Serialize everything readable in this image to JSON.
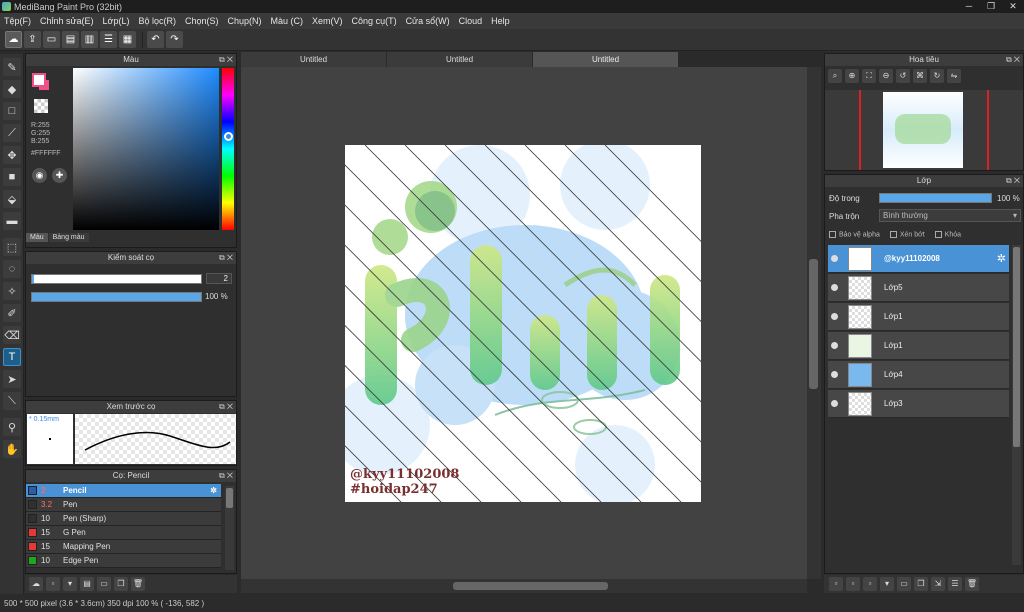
{
  "window": {
    "title": "MediBang Paint Pro (32bit)"
  },
  "menu": [
    "Tệp(F)",
    "Chỉnh sửa(E)",
    "Lớp(L)",
    "Bộ lọc(R)",
    "Chọn(S)",
    "Chụp(N)",
    "Màu (C)",
    "Xem(V)",
    "Công cụ(T)",
    "Cửa sổ(W)",
    "Cloud",
    "Help"
  ],
  "tabs": [
    "Untitled",
    "Untitled",
    "Untitled"
  ],
  "color_panel": {
    "title": "Màu",
    "rgb": [
      "R:255",
      "G:255",
      "B:255"
    ],
    "hex": "#FFFFFF",
    "tabs": [
      "Màu",
      "Bảng màu"
    ],
    "foreground": "#ffffff",
    "accent": "#f0508a"
  },
  "brush_control": {
    "title": "Kiểm soát cọ",
    "size": "2",
    "opacity": "100 %",
    "size_fraction": 0.01,
    "opacity_fraction": 1.0
  },
  "brush_preview": {
    "title": "Xem trước cọ",
    "size_label": "* 0.15mm"
  },
  "brush_list": {
    "title": "Cọ: Pencil",
    "items": [
      {
        "size": "2",
        "name": "Pencil",
        "color": "#2a5fa8",
        "selected": true
      },
      {
        "size": "3.2",
        "name": "Pen",
        "color": "#303030",
        "selected": false
      },
      {
        "size": "10",
        "name": "Pen (Sharp)",
        "color": "#303030",
        "selected": false
      },
      {
        "size": "15",
        "name": "G Pen",
        "color": "#e53935",
        "selected": false
      },
      {
        "size": "15",
        "name": "Mapping Pen",
        "color": "#e53935",
        "selected": false
      },
      {
        "size": "10",
        "name": "Edge Pen",
        "color": "#1fa81f",
        "selected": false
      }
    ]
  },
  "navigator": {
    "title": "Hoa tiêu"
  },
  "layers": {
    "title": "Lớp",
    "opacity_label": "Độ trong",
    "opacity_value": "100 %",
    "blend_label": "Pha trộn",
    "blend_value": "Bình thường",
    "options": [
      "Bảo vệ alpha",
      "Xén bớt",
      "Khóa"
    ],
    "items": [
      "@kyy11102008",
      "Lớp5",
      "Lớp1",
      "Lớp1",
      "Lớp4",
      "Lớp3"
    ]
  },
  "artwork": {
    "lettering": "Phiếu",
    "credit1": "@kyy11102008",
    "credit2": "#hoidap247"
  },
  "status": "500 * 500 pixel  (3.6 * 3.6cm)  350 dpi  100 %  ( -136, 582 )"
}
